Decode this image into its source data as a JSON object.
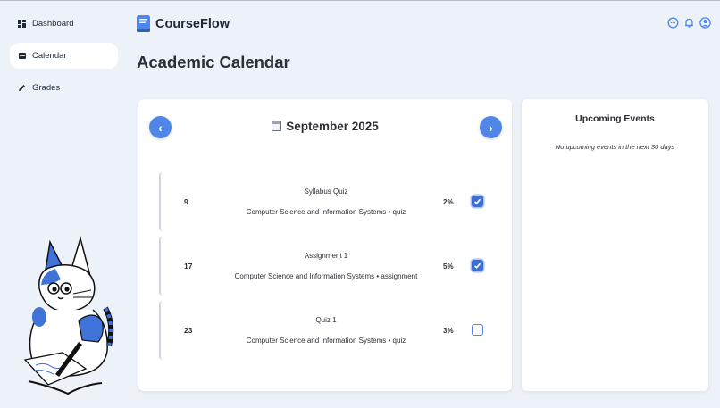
{
  "sidebar": {
    "items": [
      {
        "label": "Dashboard",
        "icon": "dashboard-icon",
        "active": false
      },
      {
        "label": "Calendar",
        "icon": "calendar-icon",
        "active": true
      },
      {
        "label": "Grades",
        "icon": "pencil-icon",
        "active": false
      }
    ]
  },
  "header": {
    "brand": "CourseFlow",
    "icons": [
      "chat-icon",
      "bell-icon",
      "user-icon"
    ]
  },
  "page": {
    "title": "Academic Calendar"
  },
  "calendar": {
    "month_label": "September 2025",
    "prev_label": "‹",
    "next_label": "›",
    "events": [
      {
        "day": "9",
        "title": "Syllabus Quiz",
        "subtitle": "Computer Science and Information Systems • quiz",
        "weight": "2%",
        "done": true
      },
      {
        "day": "17",
        "title": "Assignment 1",
        "subtitle": "Computer Science and Information Systems • assignment",
        "weight": "5%",
        "done": true
      },
      {
        "day": "23",
        "title": "Quiz 1",
        "subtitle": "Computer Science and Information Systems • quiz",
        "weight": "3%",
        "done": false
      }
    ]
  },
  "upcoming": {
    "title": "Upcoming Events",
    "empty_message": "No upcoming events in the next 30 days"
  },
  "colors": {
    "accent": "#4f86e8",
    "background": "#edf2f9",
    "card": "#ffffff"
  }
}
